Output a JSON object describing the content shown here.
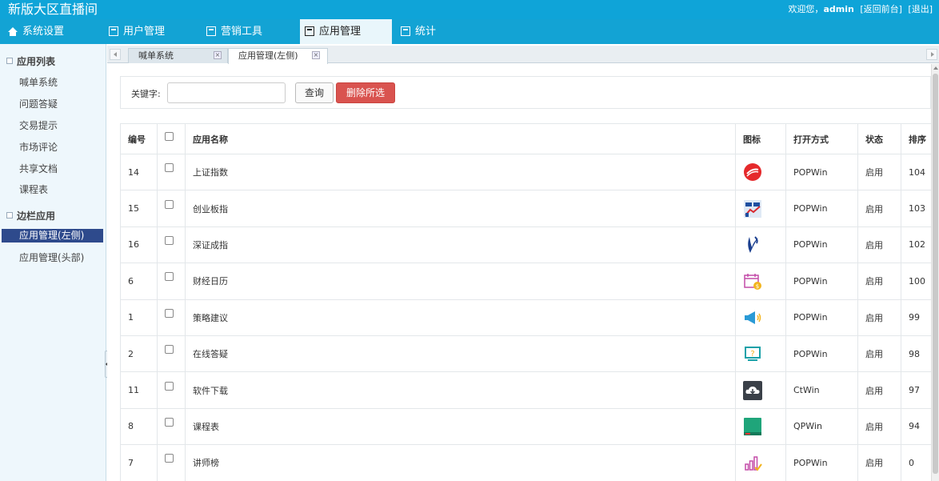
{
  "app": {
    "title": "新版大区直播间",
    "welcome": "欢迎您，",
    "username": "admin",
    "back_link": "[返回前台]",
    "logout_link": "[退出]"
  },
  "nav": {
    "items": [
      {
        "label": "系统设置",
        "icon": "home-icon"
      },
      {
        "label": "用户管理",
        "icon": "user-icon"
      },
      {
        "label": "营销工具",
        "icon": "tool-icon"
      },
      {
        "label": "应用管理",
        "icon": "app-icon",
        "active": true
      },
      {
        "label": "统计",
        "icon": "stats-icon"
      }
    ]
  },
  "sidebar": {
    "group1": "应用列表",
    "group1_items": [
      "喊单系统",
      "问题答疑",
      "交易提示",
      "市场评论",
      "共享文档",
      "课程表"
    ],
    "group2": "边栏应用",
    "group2_items": [
      "应用管理(左侧)",
      "应用管理(头部)"
    ]
  },
  "tabs": {
    "items": [
      {
        "label": "喊单系统",
        "close": "×"
      },
      {
        "label": "应用管理(左侧)",
        "close": "×",
        "active": true
      }
    ]
  },
  "search": {
    "label": "关键字:",
    "value": "",
    "placeholder": "",
    "query_button": "查询",
    "delete_button": "删除所选"
  },
  "table": {
    "columns": [
      "编号",
      "",
      "应用名称",
      "图标",
      "打开方式",
      "状态",
      "排序"
    ],
    "rows": [
      {
        "id": "14",
        "name": "上证指数",
        "icon": "shanghai-index-icon",
        "open": "POPWin",
        "status": "启用",
        "order": "104"
      },
      {
        "id": "15",
        "name": "创业板指",
        "icon": "chinext-index-icon",
        "open": "POPWin",
        "status": "启用",
        "order": "103"
      },
      {
        "id": "16",
        "name": "深证成指",
        "icon": "shenzhen-index-icon",
        "open": "POPWin",
        "status": "启用",
        "order": "102"
      },
      {
        "id": "6",
        "name": "财经日历",
        "icon": "calendar-icon",
        "open": "POPWin",
        "status": "启用",
        "order": "100"
      },
      {
        "id": "1",
        "name": "策略建议",
        "icon": "megaphone-icon",
        "open": "POPWin",
        "status": "启用",
        "order": "99"
      },
      {
        "id": "2",
        "name": "在线答疑",
        "icon": "question-screen-icon",
        "open": "POPWin",
        "status": "启用",
        "order": "98"
      },
      {
        "id": "11",
        "name": "软件下载",
        "icon": "cloud-download-icon",
        "open": "CtWin",
        "status": "启用",
        "order": "97"
      },
      {
        "id": "8",
        "name": "课程表",
        "icon": "book-icon",
        "open": "QPWin",
        "status": "启用",
        "order": "94"
      },
      {
        "id": "7",
        "name": "讲师榜",
        "icon": "ranking-chart-icon",
        "open": "POPWin",
        "status": "启用",
        "order": "0"
      }
    ]
  },
  "colors": {
    "topbar": "#0fa4d8",
    "nav": "#13a3d4",
    "sidebar_active": "#2e4a8c",
    "delete_button": "#d9534f"
  }
}
